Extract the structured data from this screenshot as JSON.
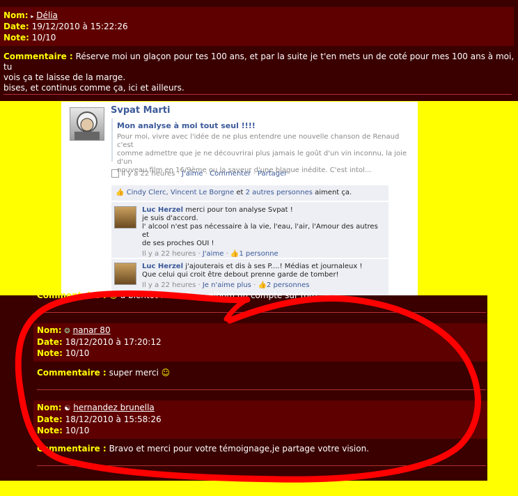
{
  "labels": {
    "nom": "Nom:",
    "date": "Date:",
    "note": "Note:",
    "commentaire": "Commentaire :"
  },
  "entry1": {
    "user": "Délia",
    "date": "19/12/2010 à 15:22:26",
    "note": "10/10",
    "comment_line1": "Réserve moi un glaçon pour tes 100 ans, et par la suite je t'en mets un de coté pour mes 100 ans à moi, tu",
    "comment_line2": "vois ça te laisse de la marge.",
    "comment_line3": "bises, et continus comme ça, ici et ailleurs."
  },
  "facebook": {
    "author": "Svpat Marti",
    "post_title": "Mon analyse à moi tout seul !!!!",
    "post_line1": "Pour moi, vivre avec l'idée de ne plus entendre une nouvelle chanson de Renaud c'est",
    "post_line2": "comme admettre que je ne découvrirai plus jamais le goût d'un vin inconnu, la joie d'un",
    "post_line3": "nouveau film en 16/9ème ou la saveur d'une blague inédite. C'est intol...",
    "post_time": "Il y a 22 heures",
    "sep": "·",
    "like": "J'aime",
    "comment": "Commenter",
    "share": "Partager",
    "likers": "Cindy Clerc, Vincent Le Borgne",
    "likers_and": "et",
    "likers_others": "2 autres personnes",
    "likers_suffix": "aiment ça.",
    "comments": [
      {
        "author": "Luc Herzel",
        "line1": "merci pour ton analyse Svpat !",
        "line2": "je suis d'accord.",
        "line3": "l' alcool n'est pas nécessaire à la vie, l'eau, l'air, l'Amour des autres et",
        "line4": "de ses proches OUI !",
        "time": "Il y a 22 heures",
        "action": "J'aime",
        "likes": "1 personne"
      },
      {
        "author": "Luc Herzel",
        "line1": "j'ajouterais et dis à ses P....! Médias et journaleux !",
        "line2": "Que celui qui croit être debout prenne garde de tomber!",
        "time": "Il y a 22 heures",
        "action": "Je n'aime plus",
        "likes": "2 personnes"
      }
    ]
  },
  "partial_comment": "à bientôt renaud , ... album un compte sur toi!!",
  "entry2": {
    "user": "nanar 80",
    "date": "18/12/2010 à 17:20:12",
    "note": "10/10",
    "comment": "super merci"
  },
  "entry3": {
    "user": "hernandez brunella",
    "date": "18/12/2010 à 15:58:26",
    "note": "10/10",
    "comment": "Bravo et merci pour votre témoignage,je partage votre vision."
  },
  "colors": {
    "page_bg": "#3a0000",
    "band_bg": "#5e0000",
    "label": "#ffff00",
    "text": "#ffffff",
    "overlay_bg": "#ffff00",
    "scribble": "#ff0000",
    "fb_link": "#3b5998"
  },
  "icons": {
    "user1": "arrow-bullet-icon",
    "user2": "motorbike-icon",
    "user3": "yin-yang-icon",
    "smiley": "smiley-icon",
    "thumb": "thumbs-up-icon"
  }
}
